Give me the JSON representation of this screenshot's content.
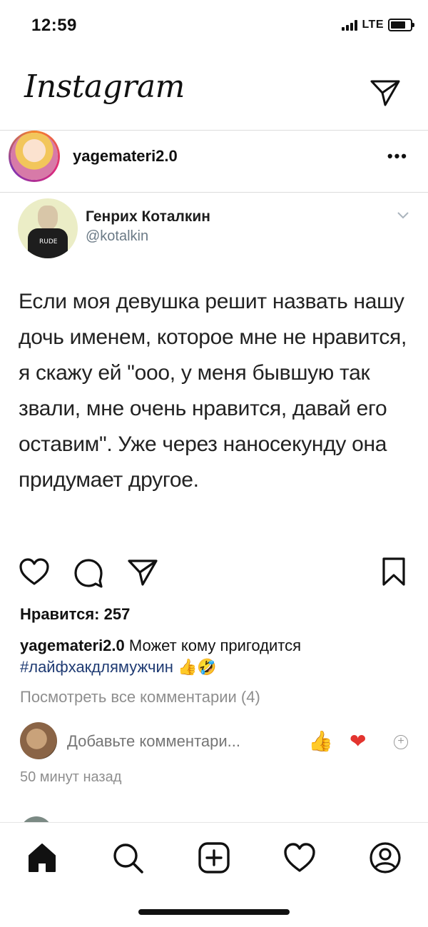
{
  "status_bar": {
    "time": "12:59",
    "network": "LTE"
  },
  "header": {
    "logo": "Instagram",
    "icons": {
      "direct": "paper-plane-icon"
    }
  },
  "post": {
    "username": "yagemateri2.0",
    "tweet": {
      "name": "Генрих Коталкин",
      "handle": "@kotalkin",
      "text": "Если моя девушка решит назвать нашу дочь именем, которое мне не нравится, я скажу ей \"ооо, у меня бывшую так звали, мне очень нравится, давай его оставим\". Уже через наносекунду она придумает другое."
    },
    "likes_label": "Нравится: 257",
    "caption": {
      "username": "yagemateri2.0",
      "text": " Может кому пригодится",
      "hashtag": "#лайфхакдлямужчин",
      "emojis": " 👍🤣"
    },
    "view_comments": "Посмотреть все комментарии (4)",
    "comment_placeholder": "Добавьте комментари...",
    "quick_reactions": [
      "👍",
      "❤"
    ],
    "time_ago": "50 минут назад"
  },
  "bottom_nav": {
    "items": [
      "home-icon",
      "search-icon",
      "new-post-icon",
      "activity-icon",
      "profile-icon"
    ]
  }
}
